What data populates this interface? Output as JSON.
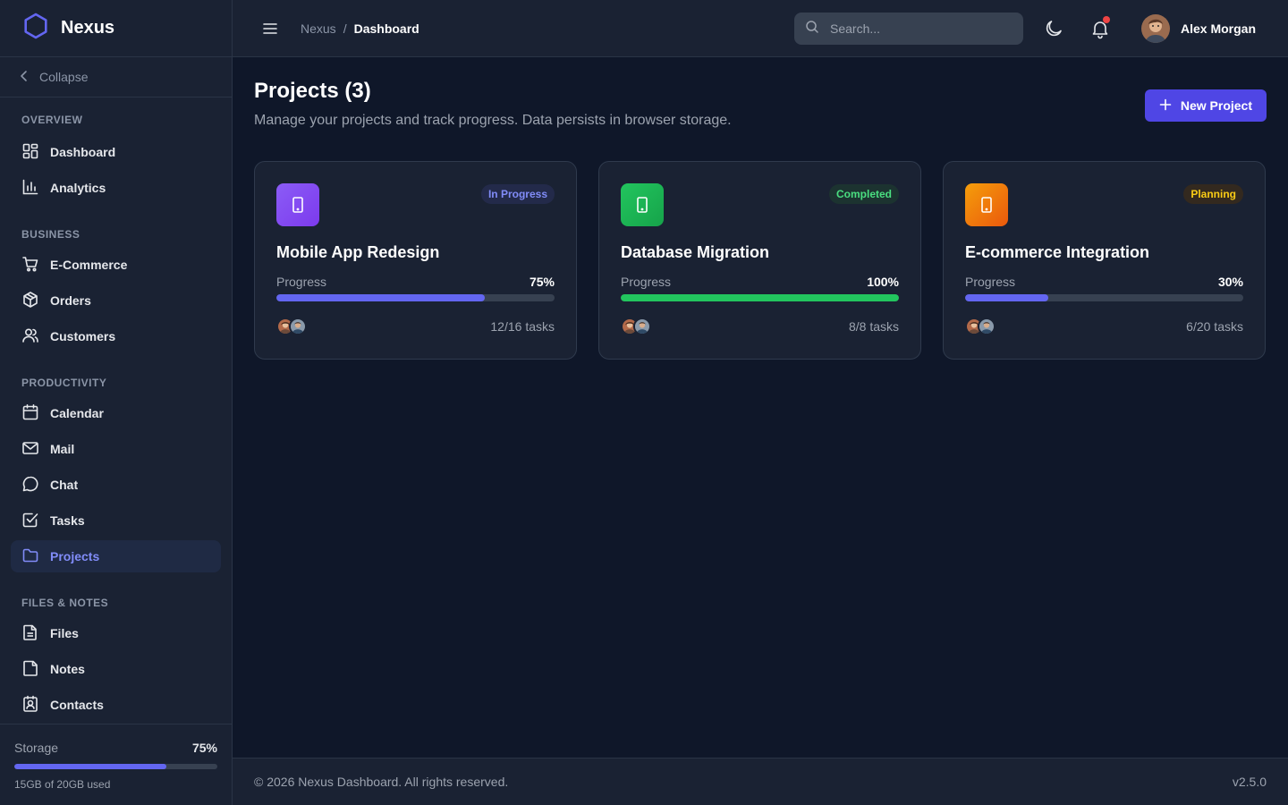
{
  "brand": {
    "name": "Nexus",
    "color": "#6366f1"
  },
  "sidebar": {
    "collapse_label": "Collapse",
    "sections": [
      {
        "title": "OVERVIEW",
        "items": [
          {
            "label": "Dashboard",
            "icon": "dashboard-icon"
          },
          {
            "label": "Analytics",
            "icon": "analytics-icon"
          }
        ]
      },
      {
        "title": "BUSINESS",
        "items": [
          {
            "label": "E-Commerce",
            "icon": "cart-icon"
          },
          {
            "label": "Orders",
            "icon": "package-icon"
          },
          {
            "label": "Customers",
            "icon": "users-icon"
          }
        ]
      },
      {
        "title": "PRODUCTIVITY",
        "items": [
          {
            "label": "Calendar",
            "icon": "calendar-icon"
          },
          {
            "label": "Mail",
            "icon": "mail-icon"
          },
          {
            "label": "Chat",
            "icon": "chat-icon"
          },
          {
            "label": "Tasks",
            "icon": "tasks-icon"
          },
          {
            "label": "Projects",
            "icon": "folder-icon",
            "active": true
          }
        ]
      },
      {
        "title": "FILES & NOTES",
        "items": [
          {
            "label": "Files",
            "icon": "file-icon"
          },
          {
            "label": "Notes",
            "icon": "note-icon"
          },
          {
            "label": "Contacts",
            "icon": "contacts-icon"
          }
        ]
      }
    ],
    "storage": {
      "label": "Storage",
      "percent": "75%",
      "fraction": 0.75,
      "used": "15GB of 20GB used"
    }
  },
  "header": {
    "breadcrumb_root": "Nexus",
    "breadcrumb_sep": "/",
    "breadcrumb_current": "Dashboard",
    "search_placeholder": "Search...",
    "user_name": "Alex Morgan"
  },
  "main": {
    "title": "Projects (3)",
    "subtitle": "Manage your projects and track progress. Data persists in browser storage.",
    "new_button": "New Project",
    "progress_label": "Progress",
    "projects": [
      {
        "title": "Mobile App Redesign",
        "status": "In Progress",
        "status_color": "#818cf8",
        "status_bg": "#232a4a",
        "icon_color": "#7c3aed",
        "icon_color2": "#8b5cf6",
        "progress": "75%",
        "fraction": 0.75,
        "bar_color": "#6366f1",
        "tasks": "12/16 tasks"
      },
      {
        "title": "Database Migration",
        "status": "Completed",
        "status_color": "#4ade80",
        "status_bg": "#1c3330",
        "icon_color": "#16a34a",
        "icon_color2": "#22c55e",
        "progress": "100%",
        "fraction": 1.0,
        "bar_color": "#22c55e",
        "tasks": "8/8 tasks"
      },
      {
        "title": "E-commerce Integration",
        "status": "Planning",
        "status_color": "#facc15",
        "status_bg": "#33291f",
        "icon_color": "#ea580c",
        "icon_color2": "#f59e0b",
        "progress": "30%",
        "fraction": 0.3,
        "bar_color": "#6366f1",
        "tasks": "6/20 tasks"
      }
    ]
  },
  "footer": {
    "copyright": "© 2026 Nexus Dashboard. All rights reserved.",
    "version": "v2.5.0"
  }
}
